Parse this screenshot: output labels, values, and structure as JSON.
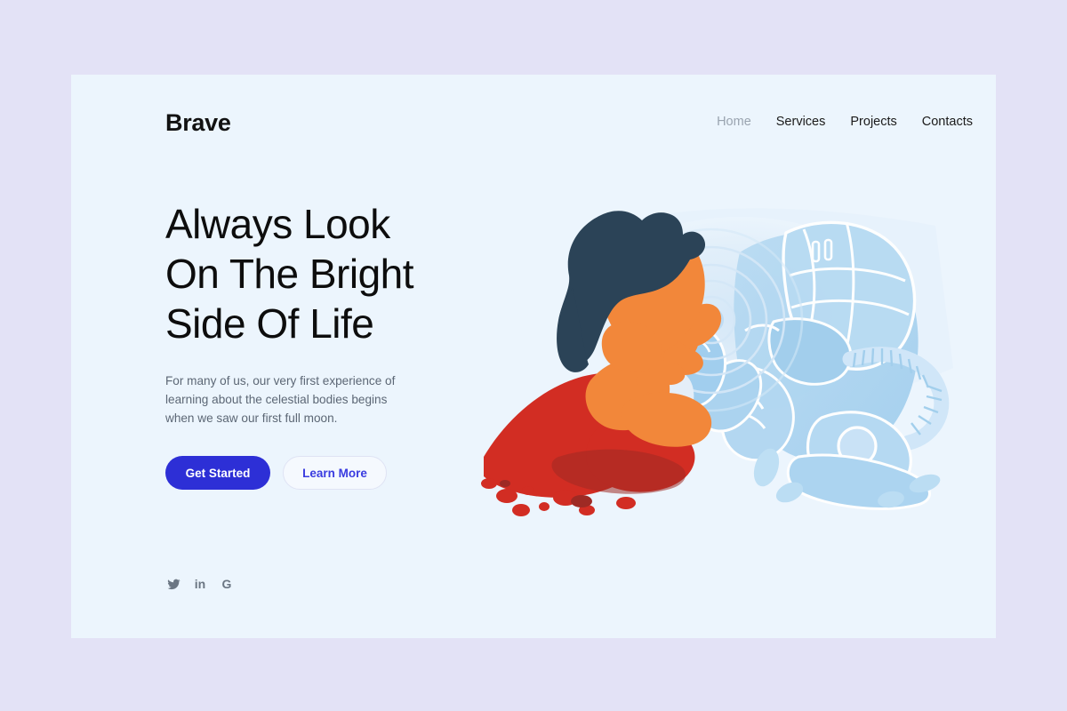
{
  "page": {
    "outer_bg": "#e3e2f6",
    "card_bg": "#ecf5fd"
  },
  "header": {
    "logo": "Brave",
    "nav": [
      {
        "label": "Home",
        "active": true
      },
      {
        "label": "Services",
        "active": false
      },
      {
        "label": "Projects",
        "active": false
      },
      {
        "label": "Contacts",
        "active": false
      }
    ]
  },
  "hero": {
    "headline_lines": [
      "Always Look",
      "On The Bright",
      "Side Of Life"
    ],
    "paragraph_lines": [
      "For many of us, our very first experience of",
      "learning about the celestial bodies begins",
      "when we saw our first full moon."
    ],
    "primary_button": "Get Started",
    "secondary_button": "Learn More",
    "colors": {
      "primary_button_bg": "#2d2fd6",
      "primary_button_text": "#ffffff",
      "secondary_button_text": "#3a3ce0",
      "secondary_button_border": "#dfe3f4",
      "headline_text": "#0d0d0d",
      "paragraph_text": "#5c6775",
      "nav_active_text": "#9aa4b0",
      "nav_text": "#1b1b1b"
    }
  },
  "socials": [
    {
      "name": "twitter-icon",
      "label": ""
    },
    {
      "name": "linkedin-icon",
      "label": "in"
    },
    {
      "name": "google-icon",
      "label": "G"
    }
  ],
  "illustration": {
    "name": "human-and-robot-touching-fingers",
    "palette": {
      "hair_navy": "#2b4357",
      "skin_orange": "#f2873a",
      "clothing_red": "#d22d23",
      "clothing_red_dark": "#9e2a24",
      "shirt_white": "#e4eef8",
      "robot_blue": "#a9d3f0",
      "robot_blue_light": "#cfe6f7",
      "robot_outline": "#ffffff",
      "glow_blue": "#ddecf9",
      "bg": "#ecf5fd"
    }
  }
}
